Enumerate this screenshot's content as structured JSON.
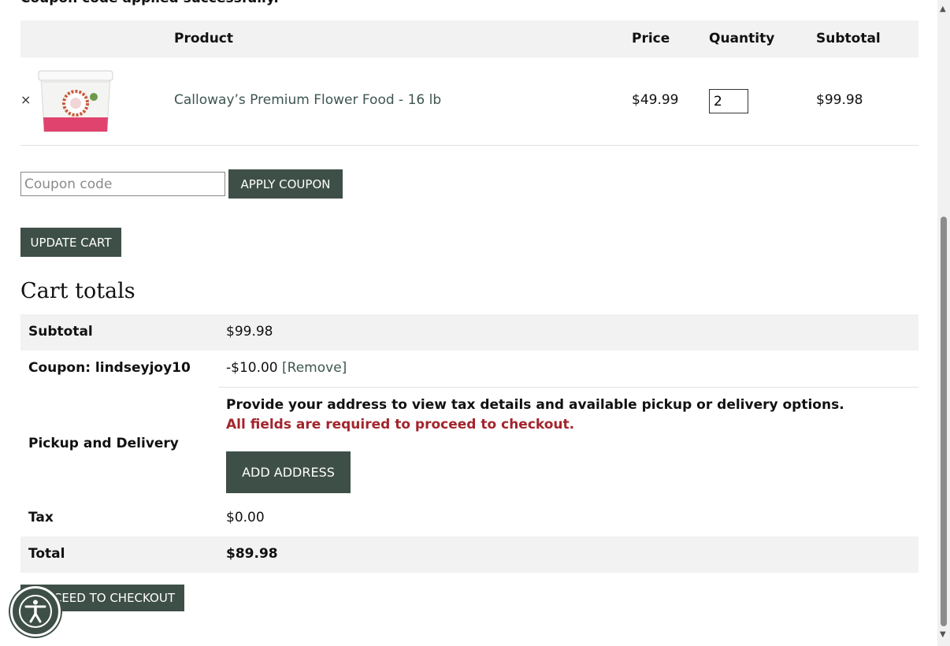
{
  "notice": "Coupon code applied successfully.",
  "cart": {
    "headers": {
      "product": "Product",
      "price": "Price",
      "quantity": "Quantity",
      "subtotal": "Subtotal"
    },
    "items": [
      {
        "remove": "×",
        "name": "Calloway’s Premium Flower Food - 16 lb",
        "price": "$49.99",
        "quantity": "2",
        "subtotal": "$99.98"
      }
    ]
  },
  "coupon": {
    "placeholder": "Coupon code",
    "apply_label": "Apply coupon"
  },
  "update_label": "Update cart",
  "totals": {
    "title": "Cart totals",
    "subtotal_label": "Subtotal",
    "subtotal_value": "$99.98",
    "coupon_label": "Coupon: lindseyjoy10",
    "coupon_value": "-$10.00",
    "coupon_remove": "[Remove]",
    "pickup_label": "Pickup and Delivery",
    "pickup_message": "Provide your address to view tax details and available pickup or delivery options.",
    "pickup_required": "All fields are required to proceed to checkout.",
    "add_address_label": "Add address",
    "tax_label": "Tax",
    "tax_value": "$0.00",
    "total_label": "Total",
    "total_value": "$89.98"
  },
  "checkout_label": "ceed to checkout",
  "icons": {
    "remove": "close-icon",
    "accessibility": "accessibility-icon",
    "scroll_up": "scroll-up-icon",
    "scroll_down": "scroll-down-icon"
  },
  "colors": {
    "button": "#3e4f48",
    "link": "#3d5550",
    "required": "#a3252c",
    "header_bg": "#f2f2f2"
  }
}
